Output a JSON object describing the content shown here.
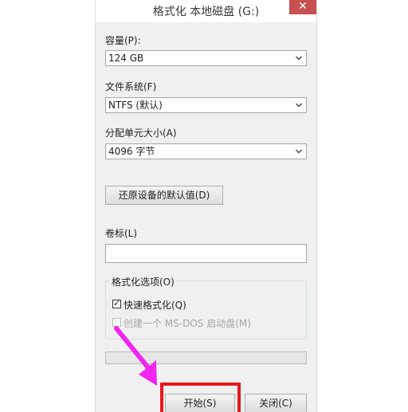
{
  "window": {
    "title": "格式化 本地磁盘 (G:)",
    "close_glyph": "✕"
  },
  "capacity": {
    "label": "容量(P):",
    "value": "124 GB"
  },
  "filesystem": {
    "label": "文件系统(F)",
    "value": "NTFS (默认)"
  },
  "allocation": {
    "label": "分配单元大小(A)",
    "value": "4096 字节"
  },
  "restore_defaults": {
    "label": "还原设备的默认值(D)"
  },
  "volume_label": {
    "label": "卷标(L)",
    "value": ""
  },
  "format_options": {
    "legend": "格式化选项(O)",
    "quick_format": {
      "label": "快速格式化(Q)",
      "checked": true
    },
    "msdos_boot": {
      "label": "创建一个 MS-DOS 启动盘(M)",
      "checked": false,
      "enabled": false
    }
  },
  "progress": {
    "fraction": 0
  },
  "buttons": {
    "start": "开始(S)",
    "close": "关闭(C)"
  },
  "annotation": {
    "arrow_color": "#f027f0",
    "highlight_color": "#e8161b"
  },
  "check_glyph": "✓"
}
